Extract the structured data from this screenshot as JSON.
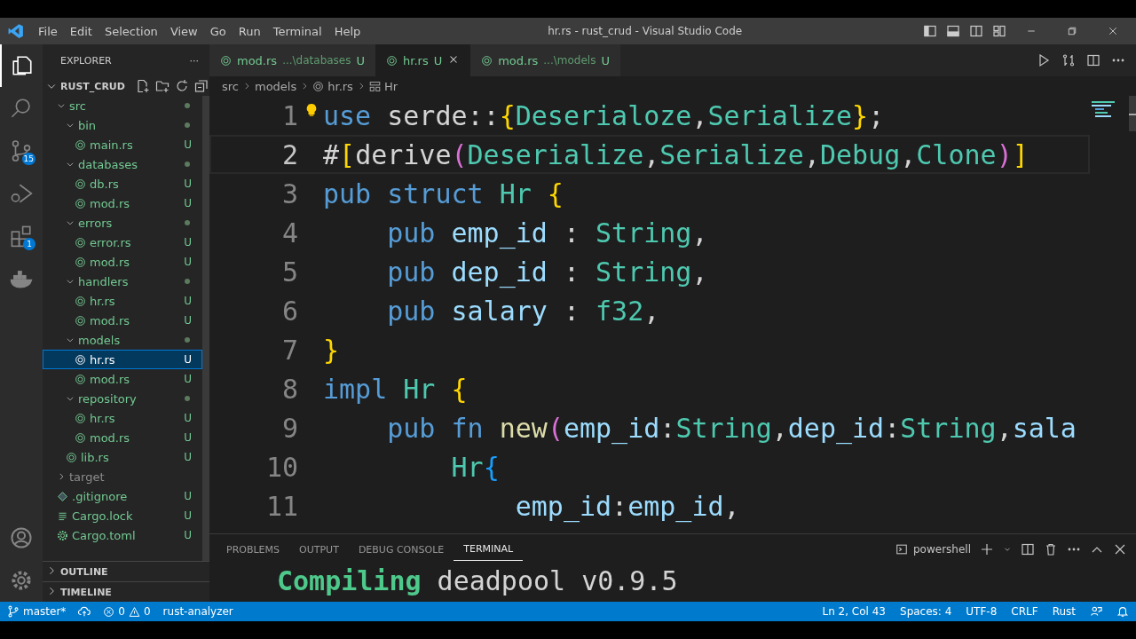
{
  "window": {
    "title": "hr.rs - rust_crud - Visual Studio Code"
  },
  "menu": [
    "File",
    "Edit",
    "Selection",
    "View",
    "Go",
    "Run",
    "Terminal",
    "Help"
  ],
  "activity_bar": [
    {
      "kind": "explorer",
      "selected": true
    },
    {
      "kind": "search",
      "selected": false
    },
    {
      "kind": "source-control",
      "selected": false,
      "badge": "15"
    },
    {
      "kind": "debug",
      "selected": false
    },
    {
      "kind": "extensions",
      "selected": false,
      "badge": "1"
    },
    {
      "kind": "docker",
      "selected": false
    }
  ],
  "sidebar": {
    "title": "EXPLORER",
    "more": "···",
    "project": "RUST_CRUD",
    "tree": [
      {
        "name": "src",
        "kind": "folder",
        "expanded": true,
        "dot": true,
        "selected": false,
        "children": [
          {
            "name": "bin",
            "kind": "folder",
            "expanded": true,
            "dot": true,
            "selected": false,
            "children": [
              {
                "name": "main.rs",
                "kind": "rust",
                "status": "U",
                "selected": false
              }
            ]
          },
          {
            "name": "databases",
            "kind": "folder",
            "expanded": true,
            "dot": true,
            "selected": false,
            "children": [
              {
                "name": "db.rs",
                "kind": "rust",
                "status": "U",
                "selected": false
              },
              {
                "name": "mod.rs",
                "kind": "rust",
                "status": "U",
                "selected": false
              }
            ]
          },
          {
            "name": "errors",
            "kind": "folder",
            "expanded": true,
            "dot": true,
            "selected": false,
            "children": [
              {
                "name": "error.rs",
                "kind": "rust",
                "status": "U",
                "selected": false
              },
              {
                "name": "mod.rs",
                "kind": "rust",
                "status": "U",
                "selected": false
              }
            ]
          },
          {
            "name": "handlers",
            "kind": "folder",
            "expanded": true,
            "dot": true,
            "selected": false,
            "children": [
              {
                "name": "hr.rs",
                "kind": "rust",
                "status": "U",
                "selected": false
              },
              {
                "name": "mod.rs",
                "kind": "rust",
                "status": "U",
                "selected": false
              }
            ]
          },
          {
            "name": "models",
            "kind": "folder",
            "expanded": true,
            "dot": true,
            "selected": false,
            "children": [
              {
                "name": "hr.rs",
                "kind": "rust",
                "status": "U",
                "selected": true
              },
              {
                "name": "mod.rs",
                "kind": "rust",
                "status": "U",
                "selected": false
              }
            ]
          },
          {
            "name": "repository",
            "kind": "folder",
            "expanded": true,
            "dot": true,
            "selected": false,
            "children": [
              {
                "name": "hr.rs",
                "kind": "rust",
                "status": "U",
                "selected": false
              },
              {
                "name": "mod.rs",
                "kind": "rust",
                "status": "U",
                "selected": false
              }
            ]
          },
          {
            "name": "lib.rs",
            "kind": "rust",
            "status": "U",
            "selected": false
          }
        ]
      },
      {
        "name": "target",
        "kind": "folder",
        "expanded": false,
        "dot": false,
        "selected": false
      },
      {
        "name": ".gitignore",
        "kind": "git",
        "status": "U",
        "selected": false
      },
      {
        "name": "Cargo.lock",
        "kind": "lock",
        "status": "U",
        "selected": false
      },
      {
        "name": "Cargo.toml",
        "kind": "toml",
        "status": "U",
        "selected": false
      }
    ],
    "sections": [
      {
        "title": "OUTLINE",
        "expanded": false
      },
      {
        "title": "TIMELINE",
        "expanded": false
      }
    ]
  },
  "tabs": [
    {
      "name": "mod.rs",
      "path": "...\\databases",
      "status": "U",
      "selected": false
    },
    {
      "name": "hr.rs",
      "status": "U",
      "selected": true
    },
    {
      "name": "mod.rs",
      "path": "...\\models",
      "status": "U",
      "selected": false
    }
  ],
  "breadcrumb": [
    "src",
    "models",
    "hr.rs",
    "Hr"
  ],
  "code": [
    {
      "number": "1",
      "current": false,
      "lightbulb": true,
      "tokens": [
        {
          "text": "use",
          "kind": "kw"
        },
        {
          "text": " serde::",
          "kind": "plain"
        },
        {
          "text": "{",
          "kind": "b1"
        },
        {
          "text": "Deserialoze",
          "kind": "type"
        },
        {
          "text": ",",
          "kind": "plain"
        },
        {
          "text": "Serialize",
          "kind": "type"
        },
        {
          "text": "}",
          "kind": "b1"
        },
        {
          "text": ";",
          "kind": "plain"
        }
      ]
    },
    {
      "number": "2",
      "current": true,
      "lightbulb": false,
      "tokens": [
        {
          "text": "#",
          "kind": "plain"
        },
        {
          "text": "[",
          "kind": "b1"
        },
        {
          "text": "derive",
          "kind": "plain"
        },
        {
          "text": "(",
          "kind": "b2"
        },
        {
          "text": "Deserialize",
          "kind": "type"
        },
        {
          "text": ",",
          "kind": "plain"
        },
        {
          "text": "Serialize",
          "kind": "type"
        },
        {
          "text": ",",
          "kind": "plain"
        },
        {
          "text": "Debug",
          "kind": "type"
        },
        {
          "text": ",",
          "kind": "plain"
        },
        {
          "text": "Clone",
          "kind": "type"
        },
        {
          "text": ")",
          "kind": "b2"
        },
        {
          "text": "]",
          "kind": "b1"
        }
      ]
    },
    {
      "number": "3",
      "current": false,
      "lightbulb": false,
      "tokens": [
        {
          "text": "pub struct",
          "kind": "kw"
        },
        {
          "text": " Hr",
          "kind": "type"
        },
        {
          "text": " {",
          "kind": "b1"
        }
      ]
    },
    {
      "number": "4",
      "current": false,
      "lightbulb": false,
      "tokens": [
        {
          "text": "    pub",
          "kind": "kw"
        },
        {
          "text": " emp_id",
          "kind": "var"
        },
        {
          "text": " : ",
          "kind": "plain"
        },
        {
          "text": "String",
          "kind": "type"
        },
        {
          "text": ",",
          "kind": "plain"
        }
      ]
    },
    {
      "number": "5",
      "current": false,
      "lightbulb": false,
      "tokens": [
        {
          "text": "    pub",
          "kind": "kw"
        },
        {
          "text": " dep_id",
          "kind": "var"
        },
        {
          "text": " : ",
          "kind": "plain"
        },
        {
          "text": "String",
          "kind": "type"
        },
        {
          "text": ",",
          "kind": "plain"
        }
      ]
    },
    {
      "number": "6",
      "current": false,
      "lightbulb": false,
      "tokens": [
        {
          "text": "    pub",
          "kind": "kw"
        },
        {
          "text": " salary",
          "kind": "var"
        },
        {
          "text": " : ",
          "kind": "plain"
        },
        {
          "text": "f32",
          "kind": "type"
        },
        {
          "text": ",",
          "kind": "plain"
        }
      ]
    },
    {
      "number": "7",
      "current": false,
      "lightbulb": false,
      "tokens": [
        {
          "text": "}",
          "kind": "b1"
        }
      ]
    },
    {
      "number": "8",
      "current": false,
      "lightbulb": false,
      "tokens": [
        {
          "text": "impl",
          "kind": "kw"
        },
        {
          "text": " Hr",
          "kind": "type"
        },
        {
          "text": " {",
          "kind": "b1"
        }
      ]
    },
    {
      "number": "9",
      "current": false,
      "lightbulb": false,
      "tokens": [
        {
          "text": "    pub fn",
          "kind": "kw"
        },
        {
          "text": " new",
          "kind": "fn"
        },
        {
          "text": "(",
          "kind": "b2"
        },
        {
          "text": "emp_id",
          "kind": "var"
        },
        {
          "text": ":",
          "kind": "plain"
        },
        {
          "text": "String",
          "kind": "type"
        },
        {
          "text": ",",
          "kind": "plain"
        },
        {
          "text": "dep_id",
          "kind": "var"
        },
        {
          "text": ":",
          "kind": "plain"
        },
        {
          "text": "String",
          "kind": "type"
        },
        {
          "text": ",",
          "kind": "plain"
        },
        {
          "text": "sala",
          "kind": "var"
        }
      ]
    },
    {
      "number": "10",
      "current": false,
      "lightbulb": false,
      "tokens": [
        {
          "text": "        Hr",
          "kind": "type"
        },
        {
          "text": "{",
          "kind": "b3"
        }
      ]
    },
    {
      "number": "11",
      "current": false,
      "lightbulb": false,
      "tokens": [
        {
          "text": "            emp_id",
          "kind": "var"
        },
        {
          "text": ":",
          "kind": "plain"
        },
        {
          "text": "emp_id",
          "kind": "var"
        },
        {
          "text": ",",
          "kind": "plain"
        }
      ]
    }
  ],
  "panel": {
    "tabs": [
      {
        "label": "PROBLEMS",
        "selected": false
      },
      {
        "label": "OUTPUT",
        "selected": false
      },
      {
        "label": "DEBUG CONSOLE",
        "selected": false
      },
      {
        "label": "TERMINAL",
        "selected": true
      }
    ],
    "shell": "powershell",
    "terminal": [
      {
        "text": "Compiling",
        "kind": "ok"
      },
      {
        "text": " deadpool v0.9.5",
        "kind": "plain"
      }
    ]
  },
  "status_bar": {
    "branch": "master*",
    "errors": "0",
    "warnings": "0",
    "items_left": [
      "rust-analyzer"
    ],
    "items_right": [
      "Ln 2, Col 43",
      "Spaces: 4",
      "UTF-8",
      "CRLF",
      "Rust"
    ]
  }
}
